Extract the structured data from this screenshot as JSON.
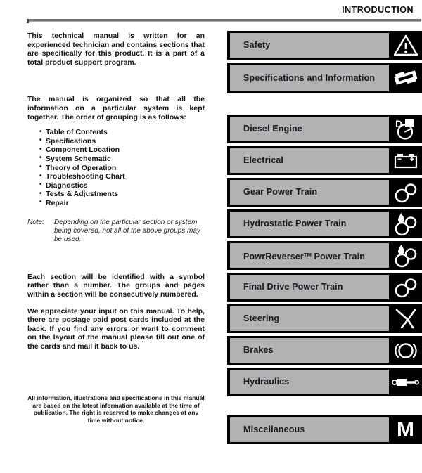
{
  "header": {
    "title": "INTRODUCTION"
  },
  "left_column": {
    "paragraphs": [
      "This technical manual is written for an experienced technician and contains sections that are specifically for this product. It is a part of a total product support program.",
      "The manual is organized so that all the information on a particular system is kept together. The order of grouping is as follows:"
    ],
    "bullets": [
      "Table of Contents",
      "Specifications",
      "Component Location",
      "System Schematic",
      "Theory of Operation",
      "Troubleshooting Chart",
      "Diagnostics",
      "Tests & Adjustments",
      "Repair"
    ],
    "note": {
      "label": "Note:",
      "text": "Depending on the particular section or system being covered, not all of the above groups may be used."
    },
    "paragraphs_after": [
      "Each section will be identified with a symbol rather than a number. The groups and pages within a section will be consecutively numbered.",
      "We appreciate your input on this manual. To help, there are postage paid post cards included at the back. If you find any errors or want to comment on the layout of the manual please fill out one of the cards and mail it back to us."
    ],
    "disclaimer": "All information, illustrations and specifications in this manual are based on the latest information available at the time of publication. The right is reserved to make changes at any time without notice."
  },
  "sections": {
    "group_a": [
      {
        "label": "Safety",
        "icon": "warning-triangle-icon"
      },
      {
        "label": "Specifications and Information",
        "icon": "specifications-plate-icon"
      }
    ],
    "group_b": [
      {
        "label": "Diesel Engine",
        "icon": "diesel-engine-icon"
      },
      {
        "label": "Electrical",
        "icon": "battery-icon"
      },
      {
        "label": "Gear Power Train",
        "icon": "gears-icon"
      },
      {
        "label": "Hydrostatic Power Train",
        "icon": "gears-droplet-icon"
      },
      {
        "label": "PowrReverser",
        "label_suffix": " Power Train",
        "trademark": "TM",
        "icon": "gears-droplet-icon"
      },
      {
        "label": "Final Drive Power Train",
        "icon": "gears-icon"
      },
      {
        "label": "Steering",
        "icon": "steering-wheel-icon"
      },
      {
        "label": "Brakes",
        "icon": "brake-disc-icon"
      },
      {
        "label": "Hydraulics",
        "icon": "hydraulic-cylinder-icon"
      }
    ],
    "group_c": [
      {
        "label": "Miscellaneous",
        "icon": "letter-m-icon",
        "glyph": "M"
      }
    ]
  },
  "colors": {
    "button_fill": "#b2b2b2",
    "button_frame": "#000000",
    "text": "#14181f",
    "rule": "#6f7175"
  }
}
